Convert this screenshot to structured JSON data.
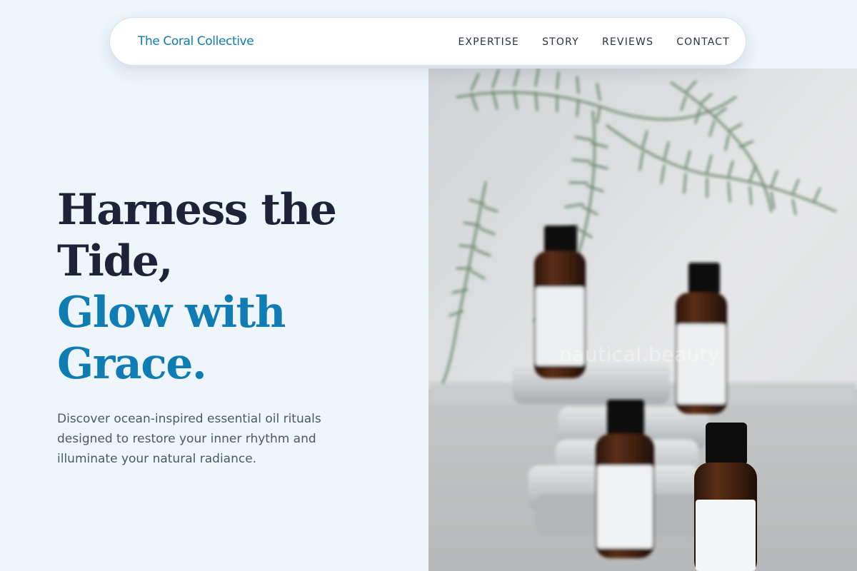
{
  "header": {
    "brand": "The Coral Collective",
    "nav": [
      {
        "label": "EXPERTISE"
      },
      {
        "label": "STORY"
      },
      {
        "label": "REVIEWS"
      },
      {
        "label": "CONTACT"
      }
    ]
  },
  "hero": {
    "headline_lines": [
      "Harness the",
      "Tide,"
    ],
    "accent_lines": [
      "Glow with",
      "Grace."
    ],
    "tagline_lines": [
      "Discover ocean-inspired essential oil rituals",
      "designed to restore your inner rhythm and",
      "illuminate your natural radiance."
    ]
  },
  "photo": {
    "watermark": "nautical.beauty"
  },
  "colors": {
    "page_background": "#eef6fc",
    "brand": "#0f7cb4",
    "headline": "#1b2537",
    "accent": "#0f7cb4",
    "body_text": "#4d5766",
    "nav_text": "#2b3340"
  }
}
